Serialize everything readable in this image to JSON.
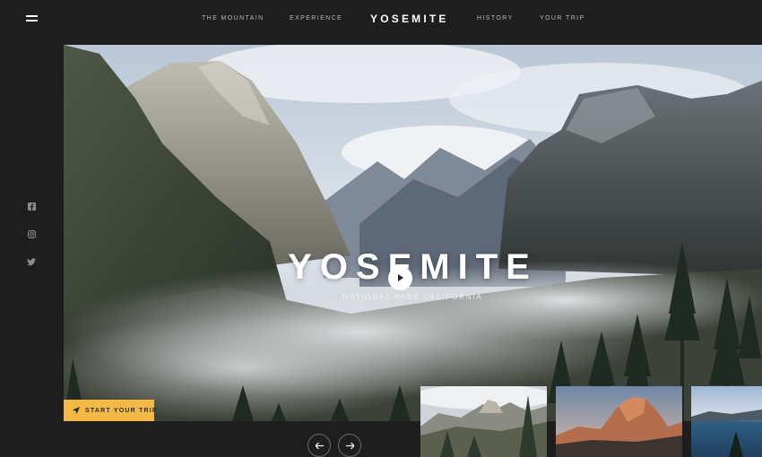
{
  "nav": {
    "left_links": [
      "THE MOUNTAIN",
      "EXPERIENCE"
    ],
    "brand": "YOSEMITE",
    "right_links": [
      "HISTORY",
      "YOUR TRIP"
    ]
  },
  "social": [
    {
      "icon": "facebook-icon"
    },
    {
      "icon": "instagram-icon"
    },
    {
      "icon": "twitter-icon"
    }
  ],
  "hero": {
    "title": "YOSEMITE",
    "subtitle": "NATIONAL PARK CALIFORNIA"
  },
  "cta": {
    "label": "START YOUR TRIP",
    "icon": "location-arrow-icon",
    "color": "#f4b944"
  },
  "slider": {
    "prev_icon": "arrow-left-icon",
    "next_icon": "arrow-right-icon"
  },
  "thumbnails": [
    {
      "subject": "valley-with-half-dome"
    },
    {
      "subject": "half-dome-at-dusk"
    },
    {
      "subject": "lake-at-dusk"
    }
  ],
  "colors": {
    "background": "#1e1e1e",
    "accent": "#f4b944",
    "nav_text": "#b9b9b9"
  }
}
